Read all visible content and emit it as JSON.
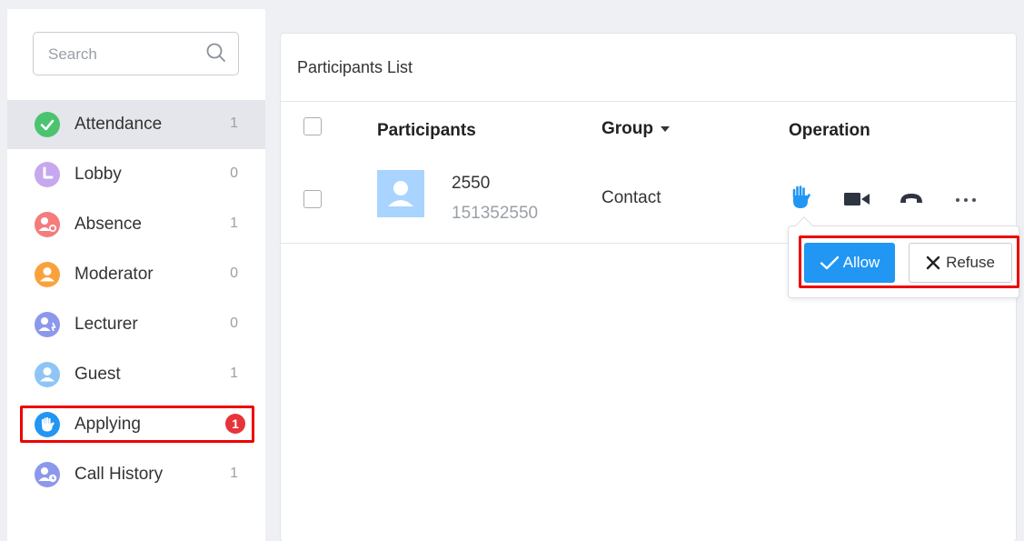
{
  "sidebar": {
    "search": {
      "placeholder": "Search",
      "icon": "search-icon"
    },
    "items": [
      {
        "label": "Attendance",
        "count": "1",
        "icon": "check-circle-icon",
        "color": "#4cc36f",
        "active": true
      },
      {
        "label": "Lobby",
        "count": "0",
        "icon": "clock-icon",
        "color": "#c6a8ef"
      },
      {
        "label": "Absence",
        "count": "1",
        "icon": "user-absent-icon",
        "color": "#f47c7c"
      },
      {
        "label": "Moderator",
        "count": "0",
        "icon": "user-icon",
        "color": "#f9a23c"
      },
      {
        "label": "Lecturer",
        "count": "0",
        "icon": "user-lecturer-icon",
        "color": "#8b98ec"
      },
      {
        "label": "Guest",
        "count": "1",
        "icon": "user-icon",
        "color": "#8ec5f5"
      },
      {
        "label": "Applying",
        "count": "1",
        "icon": "hand-icon",
        "color": "#2196f3",
        "badge": true
      },
      {
        "label": "Call History",
        "count": "1",
        "icon": "user-history-icon",
        "color": "#8b98ec"
      }
    ]
  },
  "panel": {
    "title": "Participants List",
    "columns": {
      "participants": "Participants",
      "group": "Group",
      "operation": "Operation"
    },
    "rows": [
      {
        "name": "2550",
        "number": "151352550",
        "group": "Contact"
      }
    ]
  },
  "popover": {
    "allow_label": "Allow",
    "refuse_label": "Refuse"
  },
  "colors": {
    "accent": "#2196f3",
    "badge": "#e8333a",
    "highlight": "#e00000"
  }
}
